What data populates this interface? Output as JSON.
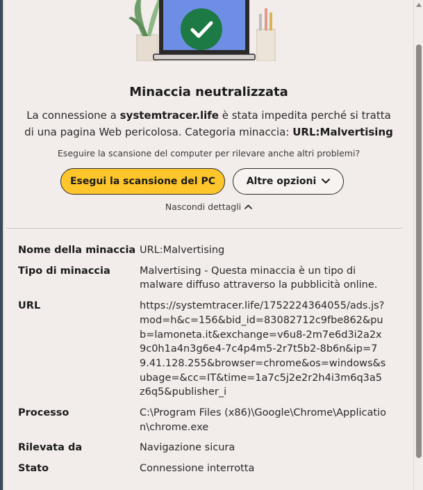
{
  "header": {
    "title": "Minaccia neutralizzata",
    "desc_prefix": "La connessione a ",
    "desc_domain": "systemtracer.life",
    "desc_middle": " è stata impedita perché si tratta di una pagina Web pericolosa. Categoria minaccia: ",
    "desc_category": "URL:Malvertising",
    "question": "Eseguire la scansione del computer per rilevare anche altri problemi?"
  },
  "actions": {
    "scan_label": "Esegui la scansione del PC",
    "more_label": "Altre opzioni",
    "hide_details_label": "Nascondi dettagli"
  },
  "details": [
    {
      "key": "Nome della minaccia",
      "value": "URL:Malvertising"
    },
    {
      "key": "Tipo di minaccia",
      "value": "Malvertising - Questa minaccia è un tipo di malware diffuso attraverso la pubblicità online."
    },
    {
      "key": "URL",
      "value": "https://systemtracer.life/1752224364055/ads.js?mod=h&c=156&bid_id=83082712c9fbe862&pub=lamoneta.it&exchange=v6u8-2m7e6d3i2a2x9c0h1a4n3g6e4-7c4p4m5-2r7t5b2-8b6n&ip=79.41.128.255&browser=chrome&os=windows&subage=&cc=IT&time=1a7c5j2e2r2h4i3m6q3a5z6q5&publisher_i"
    },
    {
      "key": "Processo",
      "value": "C:\\Program Files (x86)\\Google\\Chrome\\Application\\chrome.exe"
    },
    {
      "key": "Rilevata da",
      "value": "Navigazione sicura"
    },
    {
      "key": "Stato",
      "value": "Connessione interrotta"
    }
  ],
  "colors": {
    "background": "#f2ecea",
    "primary_button": "#ffc62b",
    "success_badge": "#1e7a45",
    "illustration_screen": "#5b7bd6"
  },
  "icons": [
    "checkmark-icon",
    "chevron-down-icon",
    "chevron-up-icon",
    "scroll-up-arrow-icon"
  ]
}
